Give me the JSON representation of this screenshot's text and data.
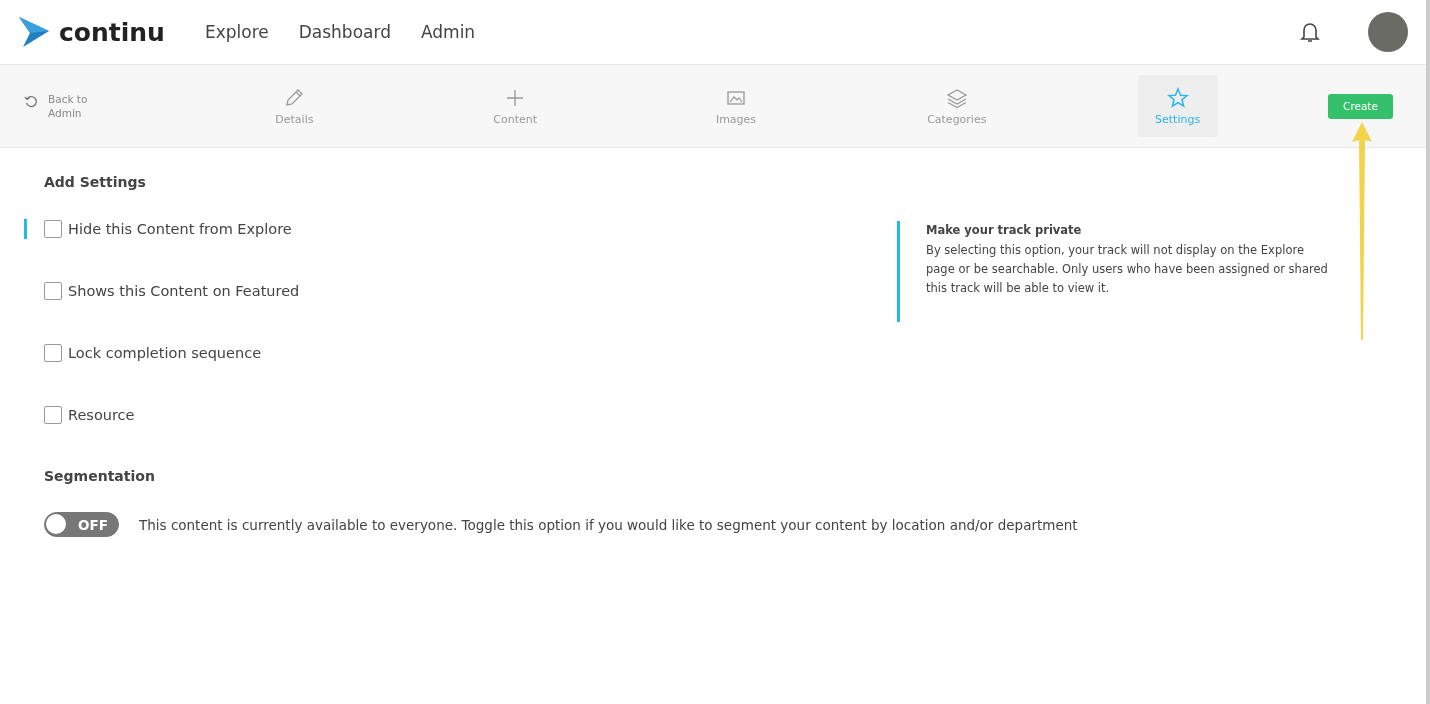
{
  "brand": {
    "name": "continu"
  },
  "nav": [
    {
      "label": "Explore"
    },
    {
      "label": "Dashboard"
    },
    {
      "label": "Admin"
    }
  ],
  "toolbar": {
    "back": "Back to\nAdmin",
    "tabs": [
      {
        "label": "Details",
        "selected": false
      },
      {
        "label": "Content",
        "selected": false
      },
      {
        "label": "Images",
        "selected": false
      },
      {
        "label": "Categories",
        "selected": false
      },
      {
        "label": "Settings",
        "selected": true
      }
    ],
    "create_button": "Create"
  },
  "settings": {
    "title": "Add Settings",
    "options": [
      {
        "label": "Hide this Content from Explore",
        "checked": false,
        "active": true
      },
      {
        "label": "Shows this Content on Featured",
        "checked": false,
        "active": false
      },
      {
        "label": "Lock completion sequence",
        "checked": false,
        "active": false
      },
      {
        "label": "Resource",
        "checked": false,
        "active": false
      }
    ],
    "help": {
      "title": "Make your track private",
      "text": "By selecting this option, your track will not display on the Explore page or be searchable. Only users who have been assigned or shared this track will be able to view it."
    }
  },
  "segmentation": {
    "title": "Segmentation",
    "toggle": {
      "on": false,
      "label": "OFF"
    },
    "description": "This content is currently available to everyone. Toggle this option if you would like to segment your content by location and/or department"
  }
}
